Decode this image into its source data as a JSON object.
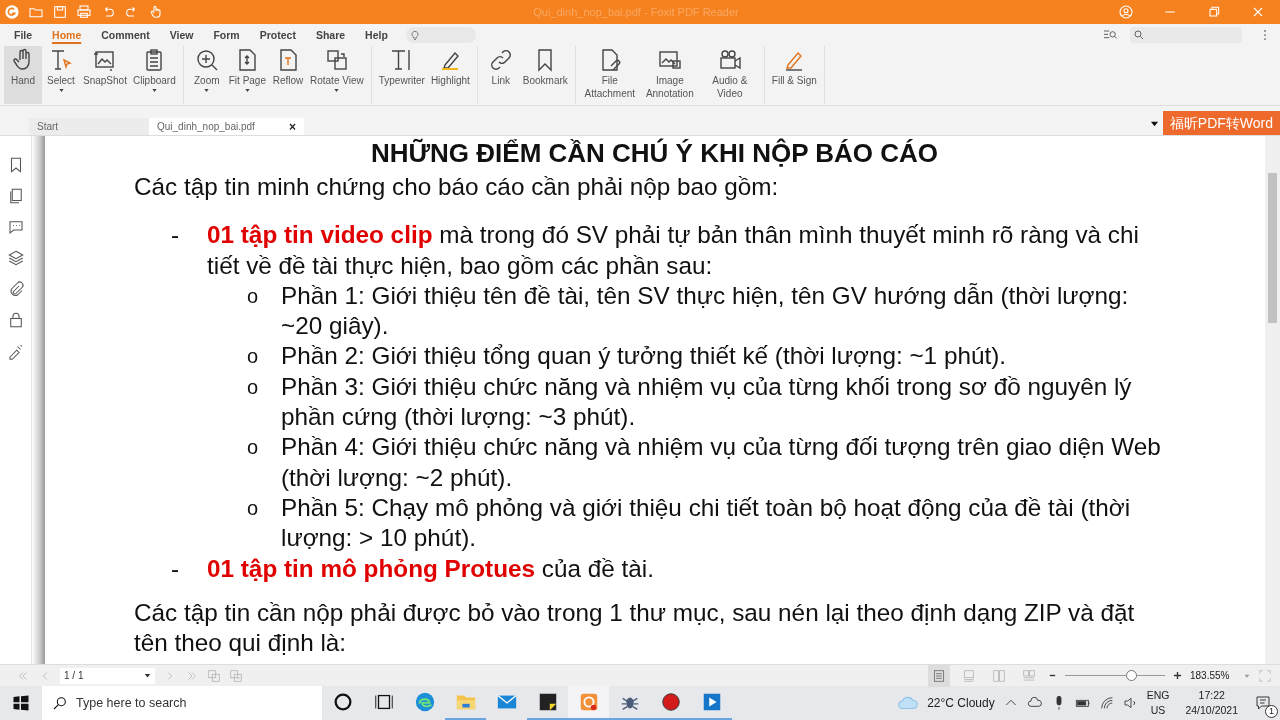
{
  "window": {
    "title": "Qui_dinh_nop_bai.pdf - Foxit PDF Reader"
  },
  "menu": [
    {
      "label": "File",
      "selected": false
    },
    {
      "label": "Home",
      "selected": true
    },
    {
      "label": "Comment",
      "selected": false
    },
    {
      "label": "View",
      "selected": false
    },
    {
      "label": "Form",
      "selected": false
    },
    {
      "label": "Protect",
      "selected": false
    },
    {
      "label": "Share",
      "selected": false
    },
    {
      "label": "Help",
      "selected": false
    }
  ],
  "ribbon": [
    [
      {
        "label": "Hand",
        "selected": true,
        "dropdown": false
      },
      {
        "label": "Select",
        "selected": false,
        "dropdown": true
      },
      {
        "label": "SnapShot",
        "selected": false,
        "dropdown": false
      },
      {
        "label": "Clipboard",
        "selected": false,
        "dropdown": true
      }
    ],
    [
      {
        "label": "Zoom",
        "selected": false,
        "dropdown": true
      },
      {
        "label": "Fit Page",
        "selected": false,
        "dropdown": true
      },
      {
        "label": "Reflow",
        "selected": false,
        "dropdown": false
      },
      {
        "label": "Rotate View",
        "selected": false,
        "dropdown": true
      }
    ],
    [
      {
        "label": "Typewriter",
        "selected": false,
        "dropdown": false
      },
      {
        "label": "Highlight",
        "selected": false,
        "dropdown": false
      }
    ],
    [
      {
        "label": "Link",
        "selected": false,
        "dropdown": false
      },
      {
        "label": "Bookmark",
        "selected": false,
        "dropdown": false
      }
    ],
    [
      {
        "label": "File Attachment",
        "selected": false,
        "dropdown": false
      },
      {
        "label": "Image Annotation",
        "selected": false,
        "dropdown": false
      },
      {
        "label": "Audio & Video",
        "selected": false,
        "dropdown": false
      }
    ],
    [
      {
        "label": "Fill & Sign",
        "selected": false,
        "dropdown": false
      }
    ]
  ],
  "doc_tabs": [
    {
      "label": "Start",
      "selected": false,
      "closable": false
    },
    {
      "label": "Qui_dinh_nop_bai.pdf",
      "selected": true,
      "closable": true
    }
  ],
  "close_glyph": "×",
  "convert_button": "福昕PDF转Word",
  "document": {
    "heading": "NHỮNG ĐIỂM CẦN CHÚ Ý KHI NỘP BÁO CÁO",
    "blocks": [
      {
        "kind": "paragraph",
        "text": "Các tập tin minh chứng cho báo cáo cần phải nộp bao gồm:"
      },
      {
        "kind": "list",
        "items": [
          {
            "marker": "-",
            "text": "**01 tập tin video clip** mà trong đó SV phải tự bản thân mình thuyết minh rõ ràng và chi tiết về đề tài thực hiện, bao gồm các phần sau:",
            "children": [
              {
                "marker": "o",
                "text": "Phần 1: Giới thiệu tên đề tài, tên SV thực hiện, tên GV hướng dẫn (thời lượng: ~20 giây)."
              },
              {
                "marker": "o",
                "text": "Phần 2: Giới thiệu tổng quan ý tưởng thiết kế (thời lượng: ~1 phút)."
              },
              {
                "marker": "o",
                "text": "Phần 3: Giới thiệu chức năng và nhiệm vụ của từng khối trong sơ đồ nguyên lý phần cứng (thời lượng: ~3 phút)."
              },
              {
                "marker": "o",
                "text": "Phần 4: Giới thiệu chức năng và nhiệm vụ của từng đối tượng trên giao diện Web (thời lượng: ~2 phút)."
              },
              {
                "marker": "o",
                "text": "Phần 5: Chạy mô phỏng và giới thiệu chi tiết toàn bộ hoạt động của đề tài (thời lượng: > 10 phút)."
              }
            ]
          },
          {
            "marker": "-",
            "text": "**01 tập tin mô phỏng Protues** của đề tài."
          }
        ]
      },
      {
        "kind": "paragraph",
        "text": "Các tập tin cần nộp phải được bỏ vào trong 1 thư mục, sau nén lại theo định dạng ZIP và đặt tên theo qui định là:"
      }
    ]
  },
  "status_bar": {
    "page": "1 / 1",
    "zoom": "183.55%",
    "zoom_slider": {
      "level": 0.66
    },
    "view_modes": [
      {
        "selected": true
      },
      {
        "selected": false
      },
      {
        "selected": false
      },
      {
        "selected": false
      }
    ]
  },
  "taskbar": {
    "search": {
      "placeholder": "Type here to search"
    },
    "apps": [
      {
        "running": false,
        "active": false
      },
      {
        "running": true,
        "active": false
      },
      {
        "running": false,
        "active": false
      },
      {
        "running": true,
        "active": false
      },
      {
        "running": true,
        "active": true
      },
      {
        "running": true,
        "active": false
      },
      {
        "running": true,
        "active": false
      },
      {
        "running": true,
        "active": false
      }
    ],
    "weather": "22°C  Cloudy",
    "language": "ENG",
    "region": "US",
    "time": "17:22",
    "date": "24/10/2021",
    "notifications": "1"
  }
}
